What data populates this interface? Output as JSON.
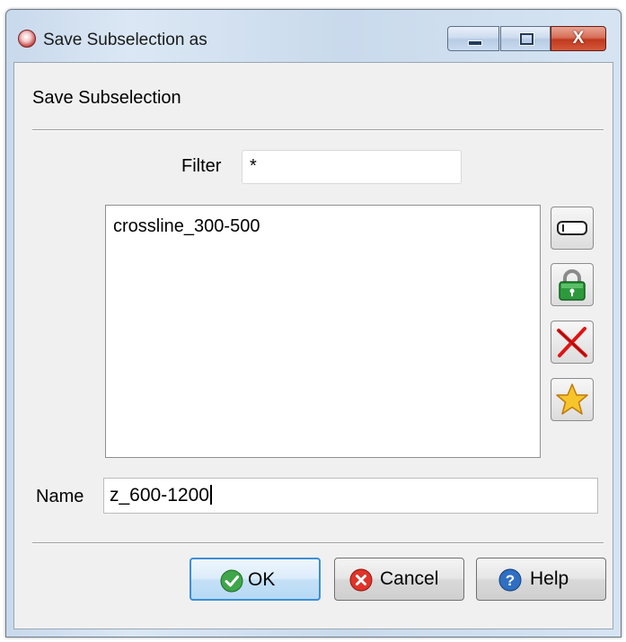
{
  "window": {
    "title": "Save Subselection as",
    "close_symbol": "X"
  },
  "dialog": {
    "header": "Save Subselection",
    "filter": {
      "label": "Filter",
      "value": "*"
    },
    "list": {
      "items": [
        "crossline_300-500"
      ]
    },
    "side_tools": [
      {
        "icon": "rectangle-select-icon"
      },
      {
        "icon": "lock-icon"
      },
      {
        "icon": "delete-x-icon"
      },
      {
        "icon": "star-icon"
      }
    ],
    "name": {
      "label": "Name",
      "value": "z_600-1200"
    },
    "buttons": {
      "ok": "OK",
      "cancel": "Cancel",
      "help": "Help"
    }
  },
  "colors": {
    "title_gradient": "#c9daec",
    "dialog_bg": "#f0f0f0",
    "ok_accent": "#3c8fd8",
    "close_red": "#c0391f"
  }
}
